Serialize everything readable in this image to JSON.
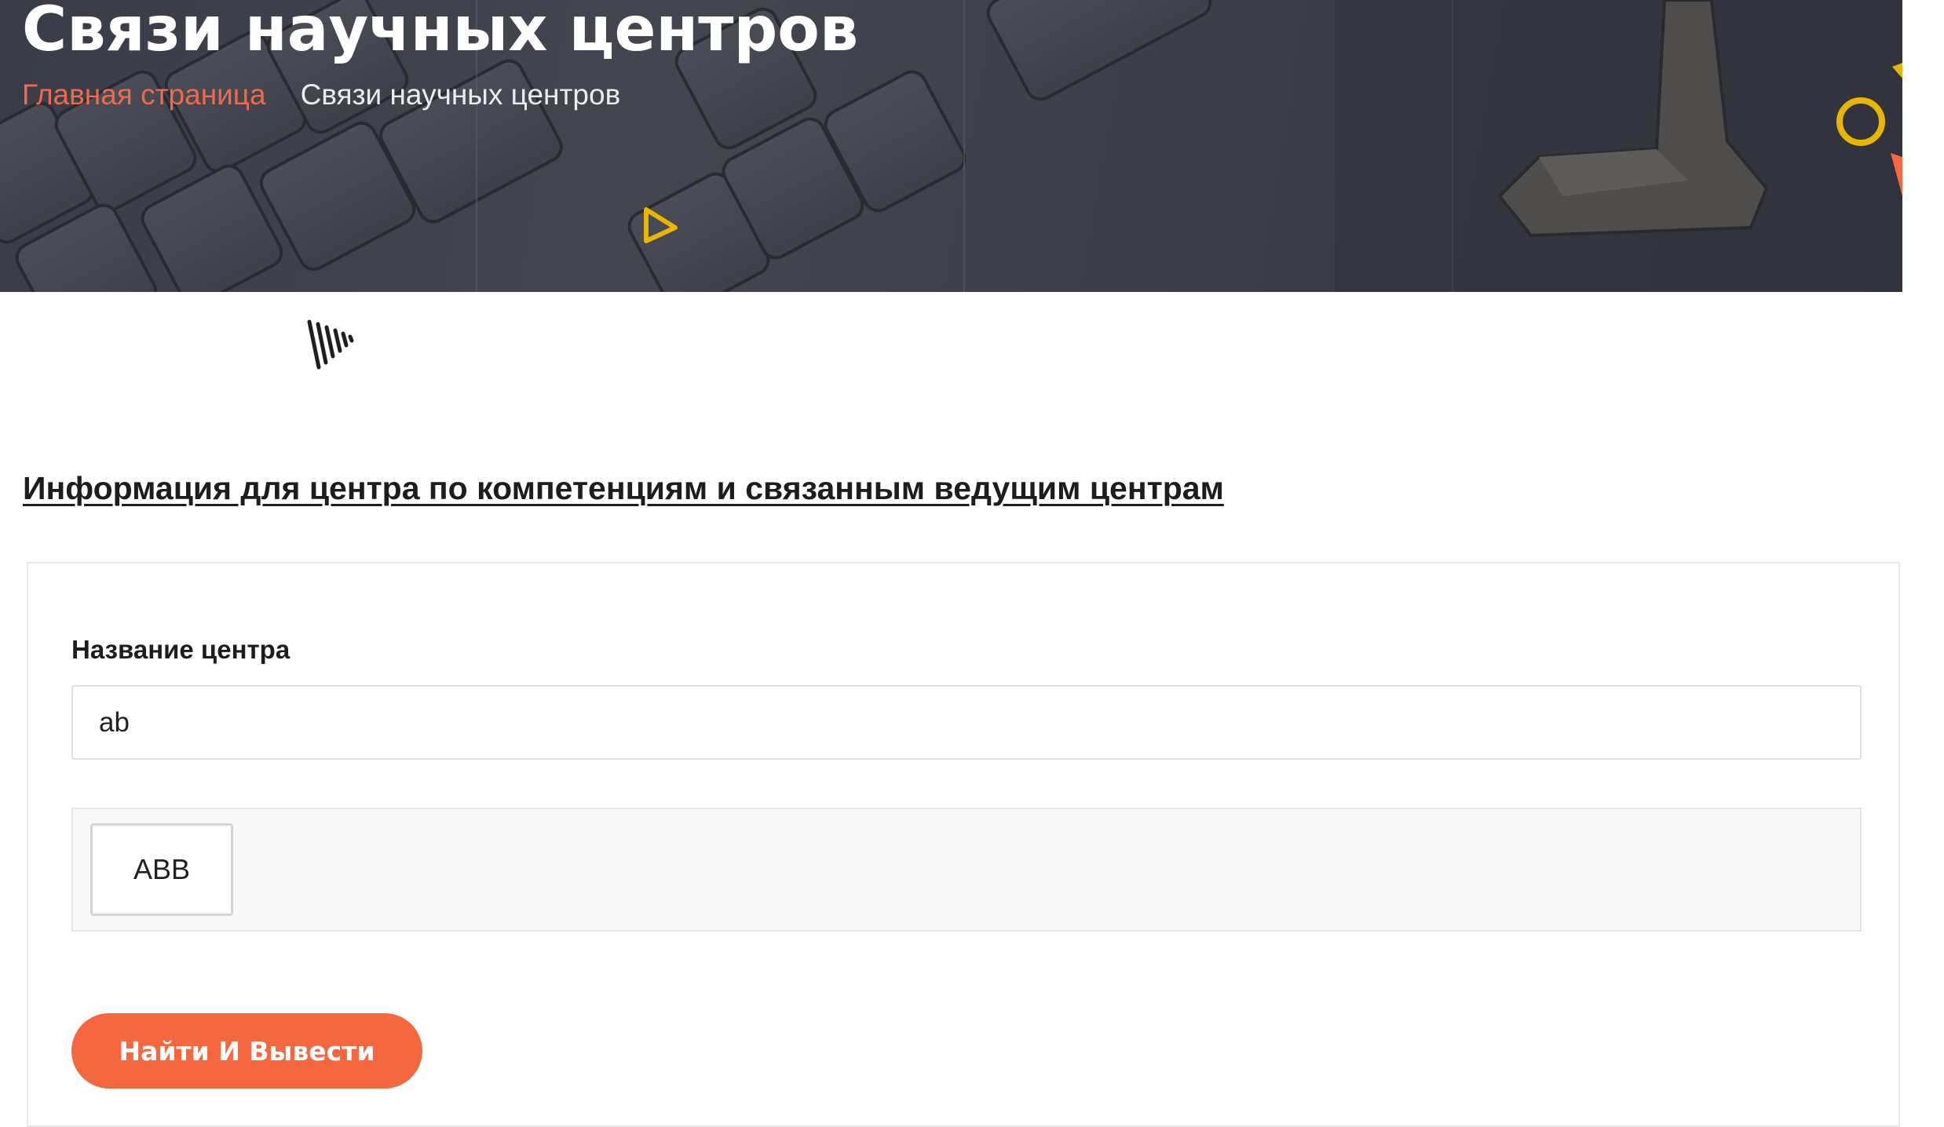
{
  "page_title": "Связи научных центров",
  "breadcrumb": {
    "home": "Главная страница",
    "current": "Связи научных центров"
  },
  "section_title": "Информация для центра по компетенциям и связанным ведущим центрам",
  "form": {
    "center_name_label": "Название центра",
    "center_name_value": "ab",
    "results": [
      "ABB"
    ],
    "submit_label": "Найти И Вывести"
  },
  "colors": {
    "accent": "#f4673f",
    "breadcrumb_link": "#ee6a4a",
    "hero_background": "#3e404b",
    "deco_yellow": "#e8b500"
  }
}
